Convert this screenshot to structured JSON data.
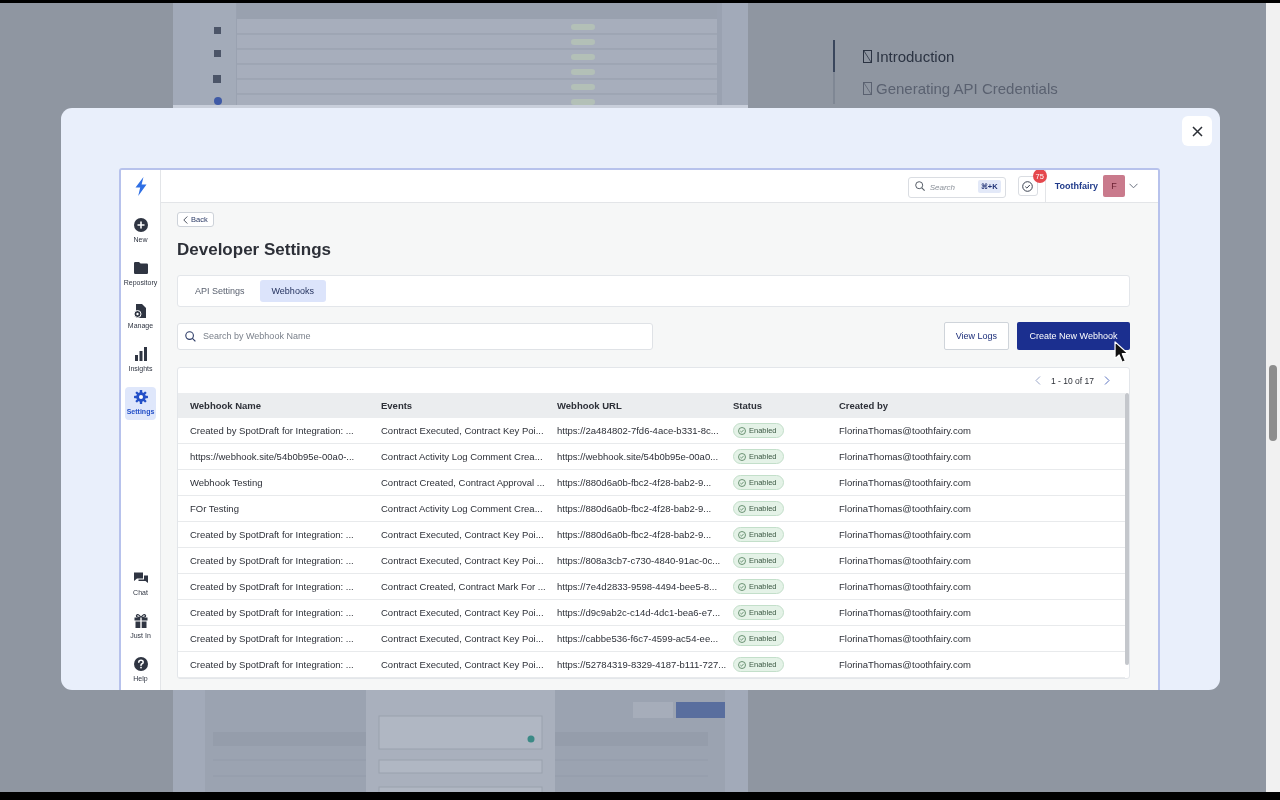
{
  "toc": [
    {
      "label": "Introduction",
      "selected": true
    },
    {
      "label": "Generating API Credentials",
      "selected": false
    }
  ],
  "app": {
    "header": {
      "search_placeholder": "Search",
      "shortcut": "⌘+K",
      "notification_count": "75",
      "user_name": "Toothfairy",
      "avatar_initial": "F"
    },
    "sidebar": {
      "top_items": [
        {
          "label": "New",
          "kind": "new",
          "selected": false
        },
        {
          "label": "Repository",
          "kind": "repository",
          "selected": false
        },
        {
          "label": "Manage",
          "kind": "manage",
          "selected": false
        },
        {
          "label": "Insights",
          "kind": "insights",
          "selected": false
        },
        {
          "label": "Settings",
          "kind": "settings",
          "selected": true
        }
      ],
      "bottom_items": [
        {
          "label": "Chat",
          "kind": "chat",
          "selected": false
        },
        {
          "label": "Just In",
          "kind": "justin",
          "selected": false
        },
        {
          "label": "Help",
          "kind": "help",
          "selected": false
        }
      ]
    },
    "back_button": "Back",
    "title": "Developer Settings",
    "tabs": [
      {
        "label": "API Settings",
        "selected": false
      },
      {
        "label": "Webhooks",
        "selected": true
      }
    ],
    "search": {
      "placeholder": "Search by Webhook Name"
    },
    "buttons": [
      {
        "label": "View Logs",
        "kind": "secondary"
      },
      {
        "label": "Create New Webhook",
        "kind": "primary"
      }
    ],
    "pagination": {
      "range": "1 - 10 of 17"
    },
    "table": {
      "columns": [
        "Webhook Name",
        "Events",
        "Webhook URL",
        "Status",
        "Created by"
      ],
      "rows": [
        {
          "name": "Created by SpotDraft for Integration: ...",
          "events": "Contract Executed, Contract Key Poi...",
          "url": "https://2a484802-7fd6-4ace-b331-8c...",
          "status": "Enabled",
          "created_by": "FlorinaThomas@toothfairy.com"
        },
        {
          "name": "https://webhook.site/54b0b95e-00a0-...",
          "events": "Contract Activity Log Comment Crea...",
          "url": "https://webhook.site/54b0b95e-00a0...",
          "status": "Enabled",
          "created_by": "FlorinaThomas@toothfairy.com"
        },
        {
          "name": "Webhook Testing",
          "events": "Contract Created, Contract Approval ...",
          "url": "https://880d6a0b-fbc2-4f28-bab2-9...",
          "status": "Enabled",
          "created_by": "FlorinaThomas@toothfairy.com"
        },
        {
          "name": "FOr Testing",
          "events": "Contract Activity Log Comment Crea...",
          "url": "https://880d6a0b-fbc2-4f28-bab2-9...",
          "status": "Enabled",
          "created_by": "FlorinaThomas@toothfairy.com"
        },
        {
          "name": "Created by SpotDraft for Integration: ...",
          "events": "Contract Executed, Contract Key Poi...",
          "url": "https://880d6a0b-fbc2-4f28-bab2-9...",
          "status": "Enabled",
          "created_by": "FlorinaThomas@toothfairy.com"
        },
        {
          "name": "Created by SpotDraft for Integration: ...",
          "events": "Contract Executed, Contract Key Poi...",
          "url": "https://808a3cb7-c730-4840-91ac-0c...",
          "status": "Enabled",
          "created_by": "FlorinaThomas@toothfairy.com"
        },
        {
          "name": "Created by SpotDraft for Integration: ...",
          "events": "Contract Created, Contract Mark For ...",
          "url": "https://7e4d2833-9598-4494-bee5-8...",
          "status": "Enabled",
          "created_by": "FlorinaThomas@toothfairy.com"
        },
        {
          "name": "Created by SpotDraft for Integration: ...",
          "events": "Contract Executed, Contract Key Poi...",
          "url": "https://d9c9ab2c-c14d-4dc1-bea6-e7...",
          "status": "Enabled",
          "created_by": "FlorinaThomas@toothfairy.com"
        },
        {
          "name": "Created by SpotDraft for Integration: ...",
          "events": "Contract Executed, Contract Key Poi...",
          "url": "https://cabbe536-f6c7-4599-ac54-ee...",
          "status": "Enabled",
          "created_by": "FlorinaThomas@toothfairy.com"
        },
        {
          "name": "Created by SpotDraft for Integration: ...",
          "events": "Contract Executed, Contract Key Poi...",
          "url": "https://52784319-8329-4187-b111-727...",
          "status": "Enabled",
          "created_by": "FlorinaThomas@toothfairy.com"
        }
      ]
    }
  }
}
